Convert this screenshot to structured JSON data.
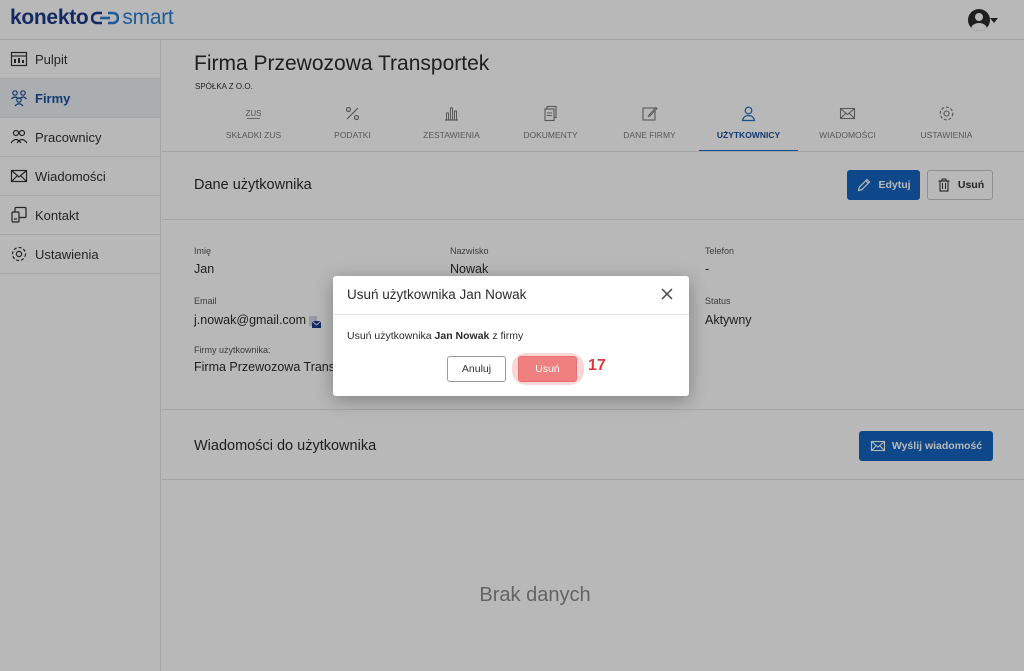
{
  "app": {
    "logo_left": "konekto",
    "logo_right": "smart"
  },
  "sidebar": {
    "items": [
      {
        "label": "Pulpit",
        "icon": "dashboard-icon"
      },
      {
        "label": "Firmy",
        "icon": "companies-icon",
        "active": true
      },
      {
        "label": "Pracownicy",
        "icon": "employees-icon"
      },
      {
        "label": "Wiadomości",
        "icon": "envelope-icon"
      },
      {
        "label": "Kontakt",
        "icon": "contact-icon"
      },
      {
        "label": "Ustawienia",
        "icon": "gear-icon"
      }
    ]
  },
  "company": {
    "name": "Firma Przewozowa Transportek",
    "legal_form": "SPÓŁKA Z O.O."
  },
  "tabs": [
    {
      "label": "SKŁADKI ZUS",
      "icon": "zus-icon",
      "icon_text": "ZUS"
    },
    {
      "label": "PODATKI",
      "icon": "percent-icon"
    },
    {
      "label": "ZESTAWIENIA",
      "icon": "bar-chart-icon"
    },
    {
      "label": "DOKUMENTY",
      "icon": "documents-icon"
    },
    {
      "label": "DANE FIRMY",
      "icon": "edit-icon"
    },
    {
      "label": "UŻYTKOWNICY",
      "icon": "user-icon",
      "active": true
    },
    {
      "label": "WIADOMOŚCI",
      "icon": "envelope-icon"
    },
    {
      "label": "USTAWIENIA",
      "icon": "gear-icon"
    }
  ],
  "user_section": {
    "title": "Dane użytkownika",
    "edit_label": "Edytuj",
    "delete_label": "Usuń",
    "fields": {
      "first_name_label": "Imię",
      "first_name_value": "Jan",
      "last_name_label": "Nazwisko",
      "last_name_value": "Nowak",
      "phone_label": "Telefon",
      "phone_value": "-",
      "email_label": "Email",
      "email_value": "j.nowak@gmail.com",
      "status_label": "Status",
      "status_value": "Aktywny",
      "companies_label": "Firmy użytkownika:",
      "companies_value": "Firma Przewozowa Transportek"
    }
  },
  "messages_section": {
    "title": "Wiadomości do użytkownika",
    "send_label": "Wyślij wiadomość",
    "empty_text": "Brak danych"
  },
  "modal": {
    "title": "Usuń użytkownika Jan Nowak",
    "message_prefix": "Usuń użytkownika ",
    "message_bold": "Jan Nowak",
    "message_suffix": " z firmy",
    "cancel_label": "Anuluj",
    "confirm_label": "Usuń",
    "step_number": "17"
  },
  "colors": {
    "primary": "#1565c0",
    "active_nav": "#1b4f9c",
    "danger_light": "#f07f7f",
    "step_red": "#e0393b"
  }
}
